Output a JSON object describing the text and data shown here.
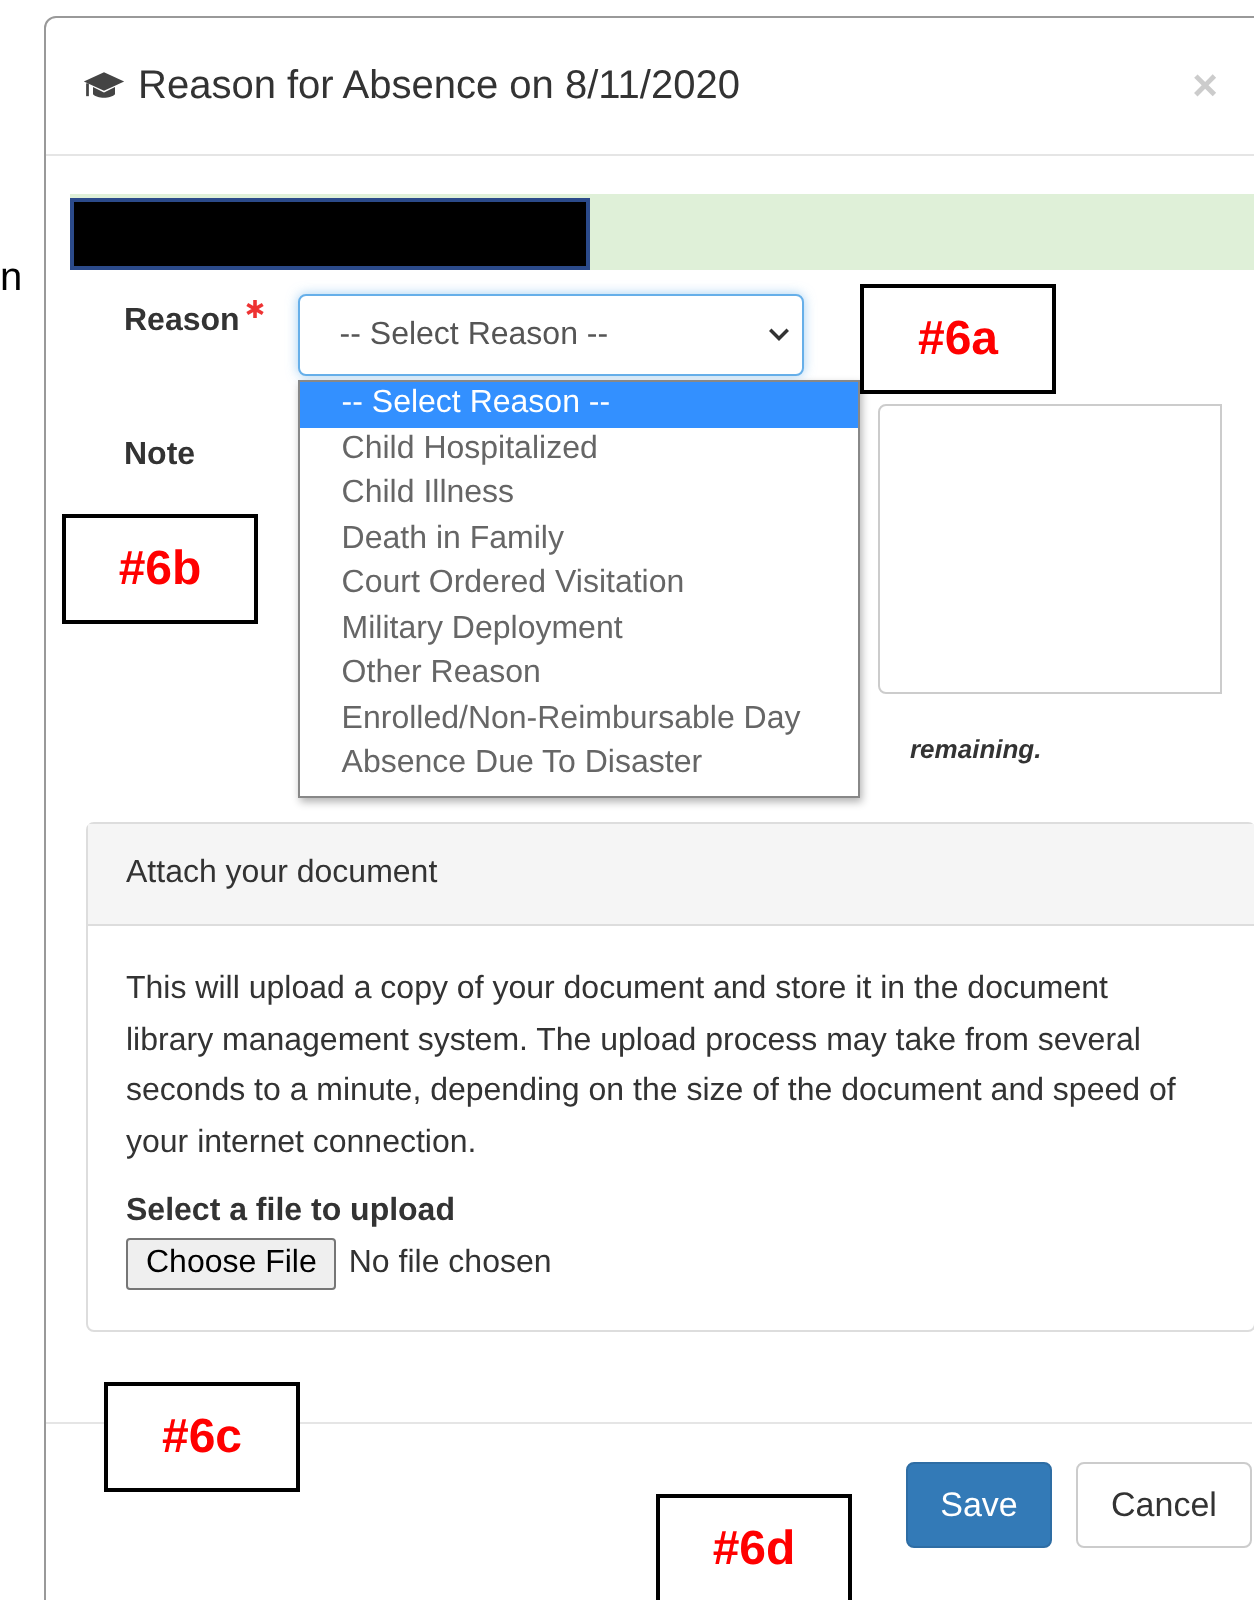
{
  "background_text": "n",
  "modal": {
    "title": "Reason for Absence on 8/11/2020",
    "close": "×"
  },
  "alert": {
    "redacted": true
  },
  "reason": {
    "label": "Reason",
    "required": true,
    "value": "-- Select Reason --",
    "expanded": true,
    "options": [
      {
        "label": "-- Select Reason --",
        "selected": true
      },
      {
        "label": "Child Hospitalized",
        "selected": false
      },
      {
        "label": "Child Illness",
        "selected": false
      },
      {
        "label": "Death in Family",
        "selected": false
      },
      {
        "label": "Court Ordered Visitation",
        "selected": false
      },
      {
        "label": "Military Deployment",
        "selected": false
      },
      {
        "label": "Other Reason",
        "selected": false
      },
      {
        "label": "Enrolled/Non-Reimbursable Day",
        "selected": false
      },
      {
        "label": "Absence Due To Disaster",
        "selected": false
      }
    ]
  },
  "note": {
    "label": "Note",
    "remaining": "remaining."
  },
  "attach": {
    "heading": "Attach your document",
    "description": "This will upload a copy of your document and store it in the document library management system. The upload process may take from several seconds to a minute, depending on the size of the document and speed of your internet connection.",
    "file_label": "Select a file to upload",
    "choose_button": "Choose File",
    "file_status": "No file chosen"
  },
  "buttons": [
    {
      "label": "Save",
      "kind": "primary"
    },
    {
      "label": "Cancel",
      "kind": "default"
    }
  ],
  "callouts": [
    {
      "label": "#6a"
    },
    {
      "label": "#6b"
    },
    {
      "label": "#6c"
    },
    {
      "label": "#6d"
    }
  ]
}
